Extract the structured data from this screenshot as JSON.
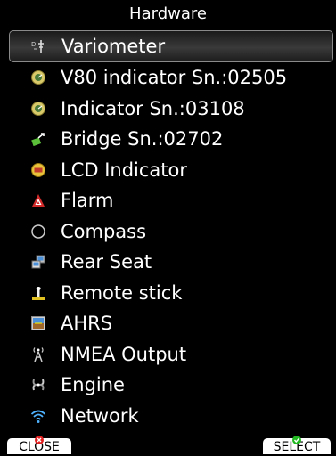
{
  "title": "Hardware",
  "menu": {
    "items": [
      {
        "label": "Variometer",
        "icon": "variometer-icon"
      },
      {
        "label": "V80 indicator Sn.:02505",
        "icon": "indicator-gauge-icon"
      },
      {
        "label": "Indicator Sn.:03108",
        "icon": "indicator-gauge-icon"
      },
      {
        "label": "Bridge Sn.:02702",
        "icon": "bridge-icon"
      },
      {
        "label": "LCD Indicator",
        "icon": "lcd-indicator-icon"
      },
      {
        "label": "Flarm",
        "icon": "flarm-icon"
      },
      {
        "label": "Compass",
        "icon": "compass-icon"
      },
      {
        "label": "Rear Seat",
        "icon": "rear-seat-icon"
      },
      {
        "label": "Remote stick",
        "icon": "remote-stick-icon"
      },
      {
        "label": "AHRS",
        "icon": "ahrs-icon"
      },
      {
        "label": "NMEA Output",
        "icon": "nmea-output-icon"
      },
      {
        "label": "Engine",
        "icon": "engine-icon"
      },
      {
        "label": "Network",
        "icon": "network-icon"
      }
    ],
    "selected_index": 0
  },
  "buttons": {
    "close_label": "CLOSE",
    "select_label": "SELECT"
  },
  "colors": {
    "background": "#000000",
    "text": "#ffffff",
    "close_badge": "#e02020",
    "select_badge": "#22b822"
  }
}
